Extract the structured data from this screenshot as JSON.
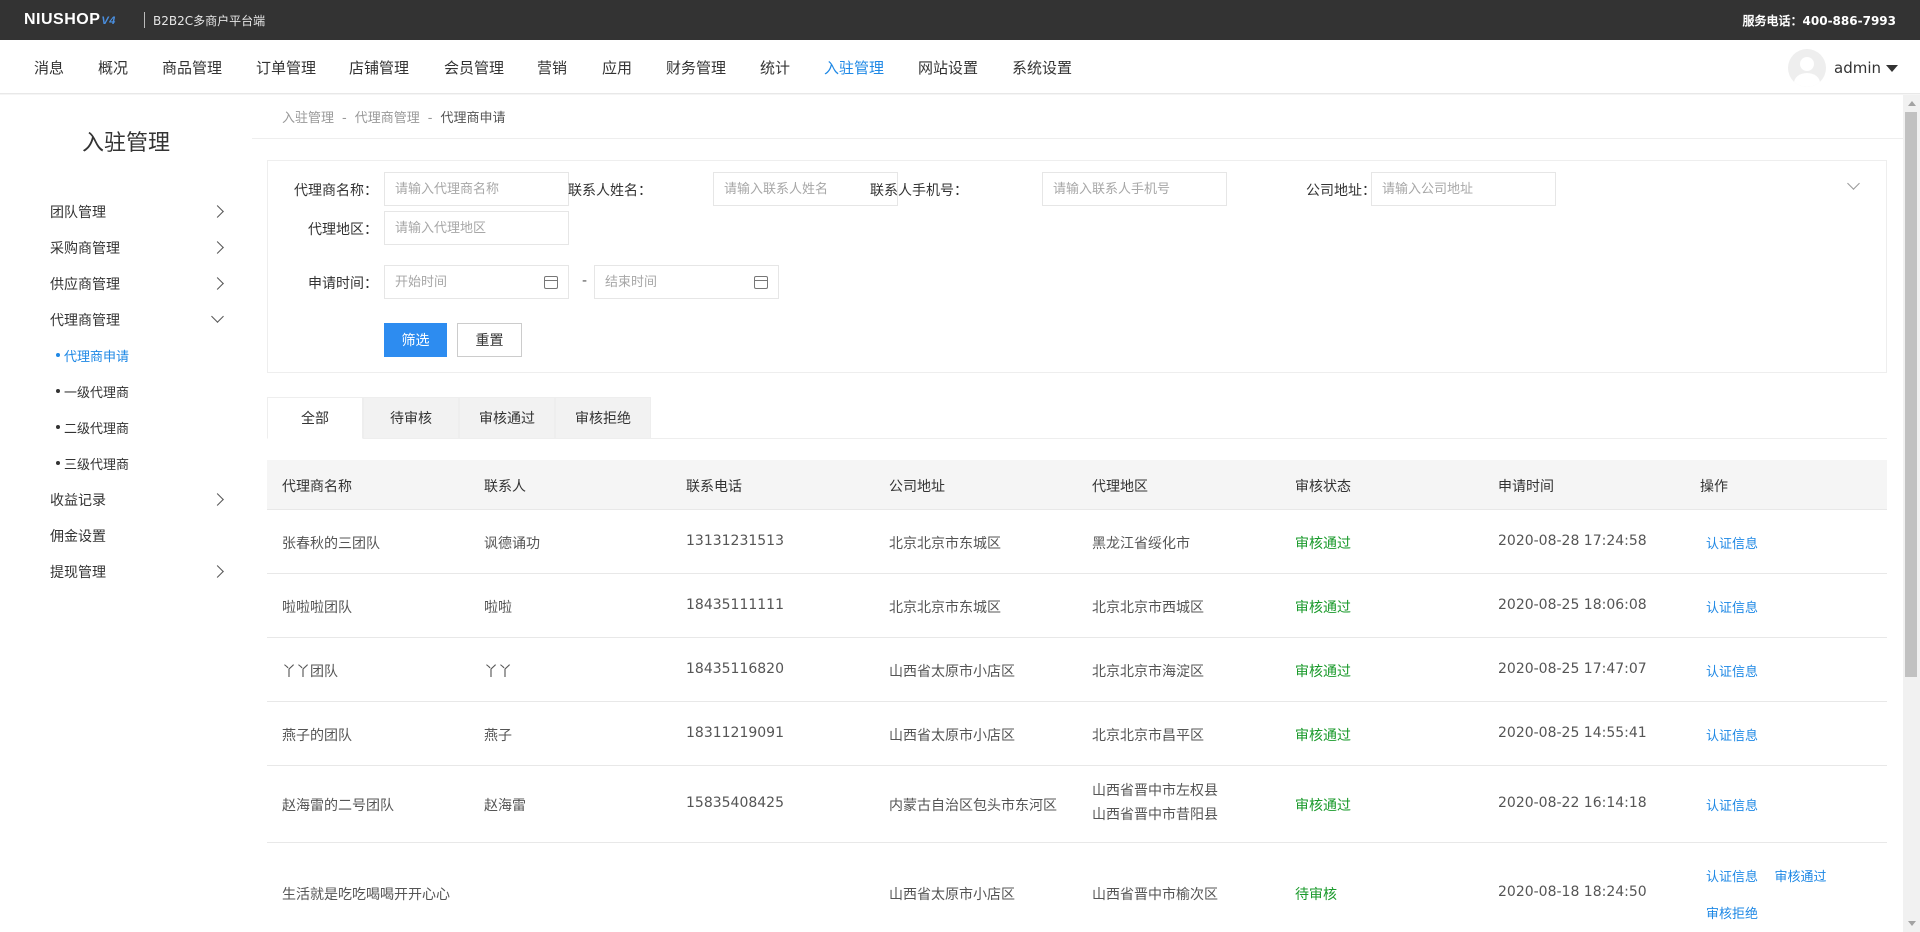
{
  "topbar": {
    "logo": "NIUSHOP",
    "logo_version": "V4",
    "subtitle": "B2B2C多商户平台端",
    "service": "服务电话：400-886-7993"
  },
  "nav": {
    "items": [
      "消息",
      "概况",
      "商品管理",
      "订单管理",
      "店铺管理",
      "会员管理",
      "营销",
      "应用",
      "财务管理",
      "统计",
      "入驻管理",
      "网站设置",
      "系统设置"
    ],
    "active": "入驻管理",
    "user": "admin"
  },
  "sidebar": {
    "title": "入驻管理",
    "items": [
      {
        "label": "团队管理"
      },
      {
        "label": "采购商管理"
      },
      {
        "label": "供应商管理"
      },
      {
        "label": "代理商管理"
      },
      {
        "label": "收益记录"
      },
      {
        "label": "佣金设置"
      },
      {
        "label": "提现管理"
      }
    ],
    "sub_items": [
      {
        "label": "代理商申请"
      },
      {
        "label": "一级代理商"
      },
      {
        "label": "二级代理商"
      },
      {
        "label": "三级代理商"
      }
    ]
  },
  "breadcrumb": [
    "入驻管理",
    "代理商管理",
    "代理商申请"
  ],
  "breadcrumb_sep": "-",
  "filter": {
    "agent_name_label": "代理商名称：",
    "agent_name_placeholder": "请输入代理商名称",
    "contact_name_label": "联系人姓名：",
    "contact_name_placeholder": "请输入联系人姓名",
    "contact_phone_label": "联系人手机号：",
    "contact_phone_placeholder": "请输入联系人手机号",
    "company_address_label": "公司地址：",
    "company_address_placeholder": "请输入公司地址",
    "region_label": "代理地区：",
    "region_placeholder": "请输入代理地区",
    "apply_time_label": "申请时间：",
    "start_placeholder": "开始时间",
    "end_placeholder": "结束时间",
    "dash": "-",
    "filter_btn": "筛选",
    "reset_btn": "重置"
  },
  "tabs": [
    "全部",
    "待审核",
    "审核通过",
    "审核拒绝"
  ],
  "table": {
    "headers": [
      "代理商名称",
      "联系人",
      "联系电话",
      "公司地址",
      "代理地区",
      "审核状态",
      "申请时间",
      "操作"
    ],
    "rows": [
      {
        "name": "张春秋的三团队",
        "contact": "讽德诵功",
        "phone": "13131231513",
        "address": "北京北京市东城区",
        "region": [
          "黑龙江省绥化市"
        ],
        "status": "审核通过",
        "time": "2020-08-28 17:24:58",
        "ops": [
          "认证信息"
        ]
      },
      {
        "name": "啦啦啦团队",
        "contact": "啦啦",
        "phone": "18435111111",
        "address": "北京北京市东城区",
        "region": [
          "北京北京市西城区"
        ],
        "status": "审核通过",
        "time": "2020-08-25 18:06:08",
        "ops": [
          "认证信息"
        ]
      },
      {
        "name": "丫丫团队",
        "contact": "丫丫",
        "phone": "18435116820",
        "address": "山西省太原市小店区",
        "region": [
          "北京北京市海淀区"
        ],
        "status": "审核通过",
        "time": "2020-08-25 17:47:07",
        "ops": [
          "认证信息"
        ]
      },
      {
        "name": "燕子的团队",
        "contact": "燕子",
        "phone": "18311219091",
        "address": "山西省太原市小店区",
        "region": [
          "北京北京市昌平区"
        ],
        "status": "审核通过",
        "time": "2020-08-25 14:55:41",
        "ops": [
          "认证信息"
        ]
      },
      {
        "name": "赵海雷的二号团队",
        "contact": "赵海雷",
        "phone": "15835408425",
        "address": "内蒙古自治区包头市东河区",
        "region": [
          "山西省晋中市左权县",
          "山西省晋中市昔阳县"
        ],
        "status": "审核通过",
        "time": "2020-08-22 16:14:18",
        "ops": [
          "认证信息"
        ]
      },
      {
        "name": "生活就是吃吃喝喝开开心心",
        "contact": "",
        "phone": "",
        "address": "山西省太原市小店区",
        "region": [
          "山西省晋中市榆次区"
        ],
        "status": "待审核",
        "time": "2020-08-18 18:24:50",
        "ops": [
          "认证信息",
          "审核通过",
          "审核拒绝"
        ]
      }
    ]
  },
  "colors": {
    "accent": "#1e88e5",
    "primary_button": "#2d8cf0",
    "status_green": "#1a9a2b",
    "topbar": "#333333"
  }
}
